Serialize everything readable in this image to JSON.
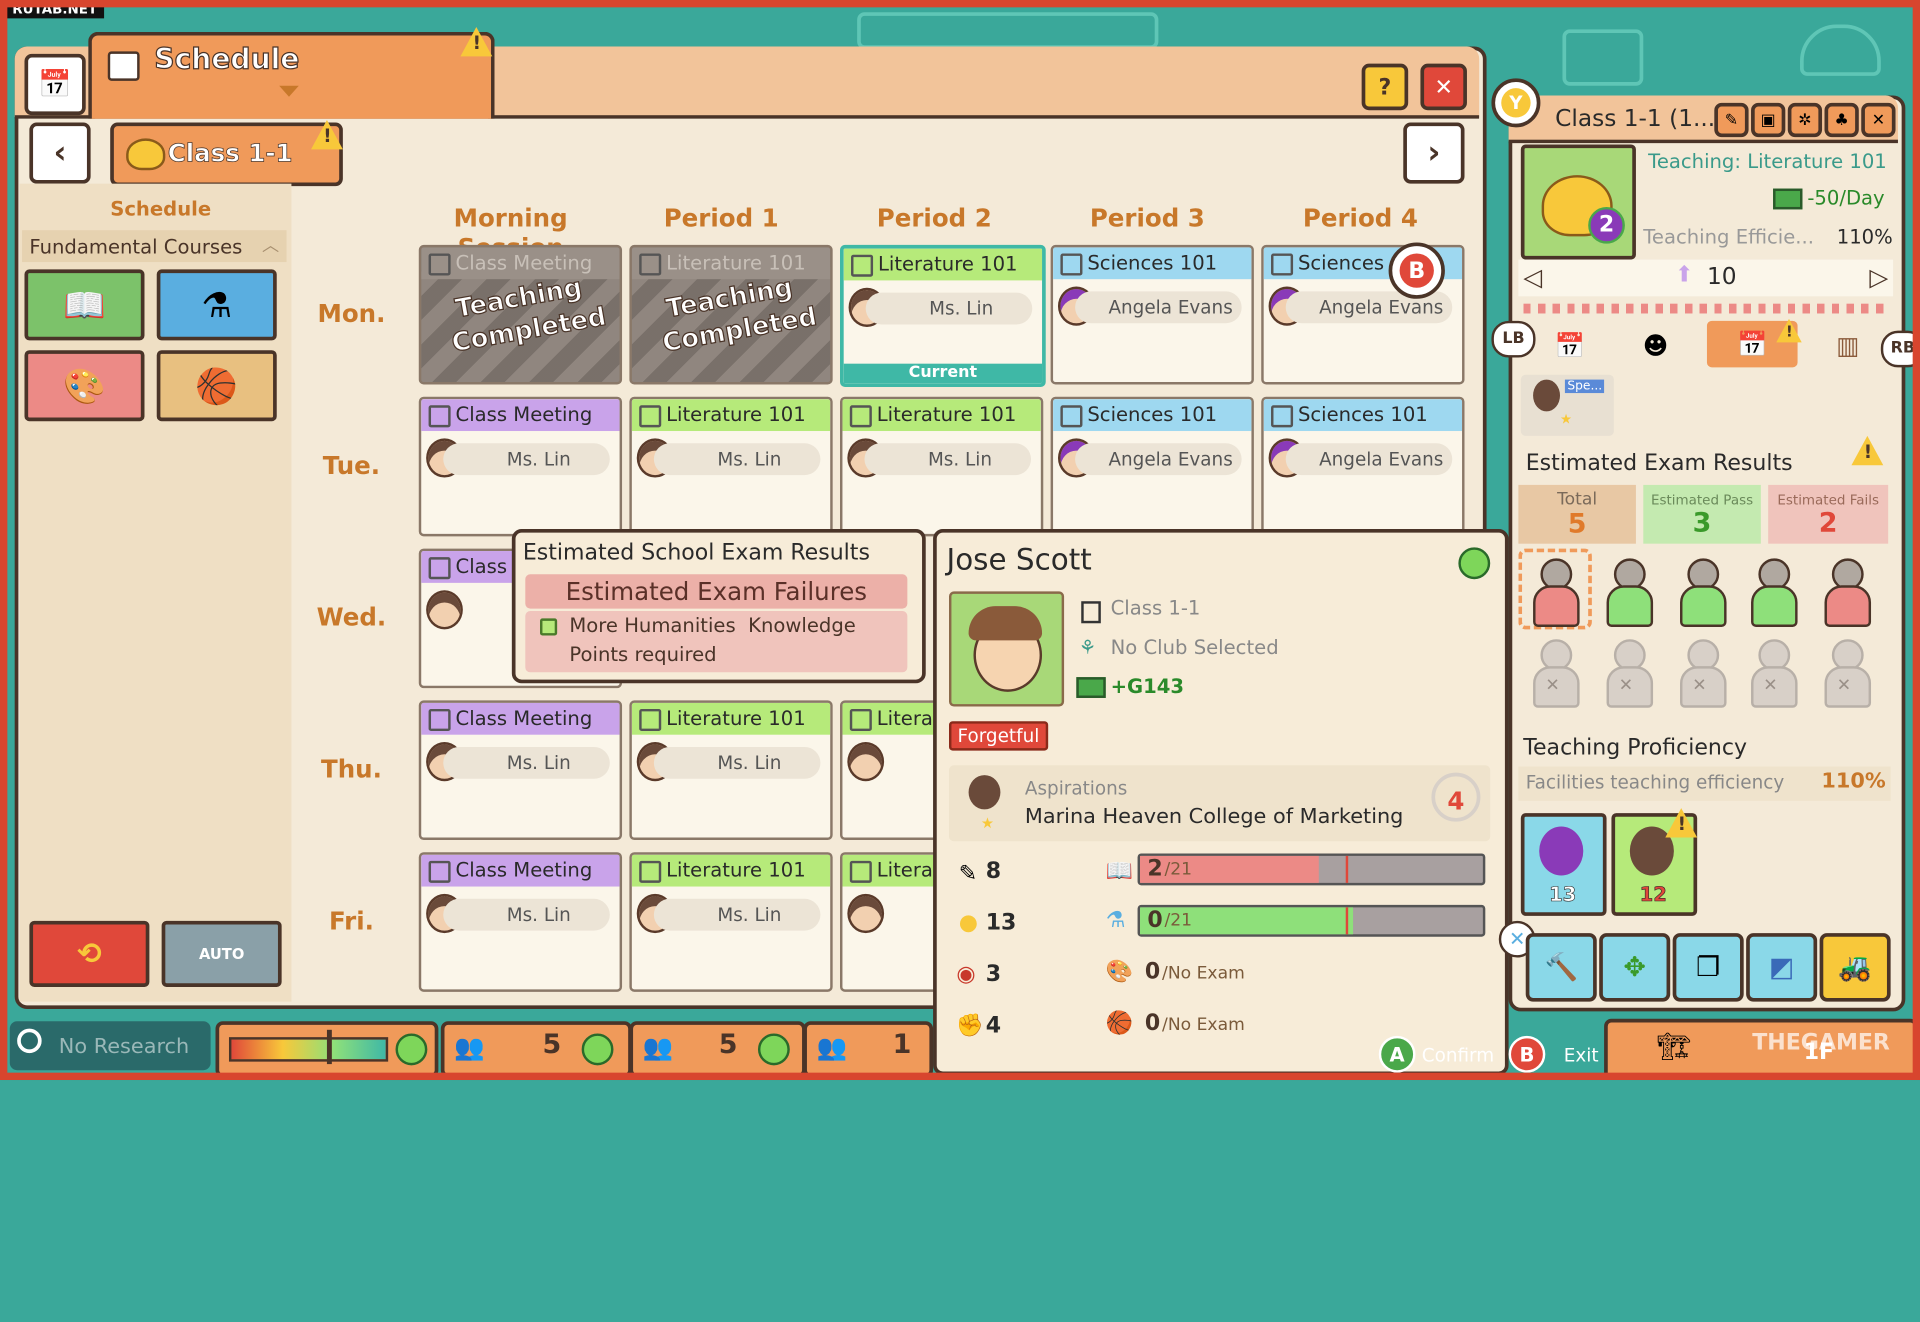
{
  "watermark": "RUTAB.NET",
  "schedule_window": {
    "title": "Schedule",
    "class_button": "Class 1-1",
    "sidebar_title": "Schedule",
    "fundamental_header": "Fundamental Courses",
    "columns": [
      "Morning Session",
      "Period 1",
      "Period 2",
      "Period 3",
      "Period 4"
    ],
    "days": [
      "Mon.",
      "Tue.",
      "Wed.",
      "Thu.",
      "Fri."
    ],
    "completed_text_1": "Teaching",
    "completed_text_2": "Completed",
    "current_label": "Current",
    "cells": {
      "mon0": {
        "course": "Class Meeting"
      },
      "mon1": {
        "course": "Literature 101"
      },
      "mon2": {
        "course": "Literature 101",
        "teacher": "Ms. Lin"
      },
      "mon3": {
        "course": "Sciences 101",
        "teacher": "Angela Evans"
      },
      "mon4": {
        "course": "Sciences",
        "teacher": "Angela Evans"
      },
      "tue0": {
        "course": "Class Meeting",
        "teacher": "Ms. Lin"
      },
      "tue1": {
        "course": "Literature 101",
        "teacher": "Ms. Lin"
      },
      "tue2": {
        "course": "Literature 101",
        "teacher": "Ms. Lin"
      },
      "tue3": {
        "course": "Sciences 101",
        "teacher": "Angela Evans"
      },
      "tue4": {
        "course": "Sciences 101",
        "teacher": "Angela Evans"
      },
      "wed0": {
        "course": "Class"
      },
      "thu0": {
        "course": "Class Meeting",
        "teacher": "Ms. Lin"
      },
      "thu1": {
        "course": "Literature 101",
        "teacher": "Ms. Lin"
      },
      "thu2": {
        "course": "Litera"
      },
      "fri0": {
        "course": "Class Meeting",
        "teacher": "Ms. Lin"
      },
      "fri1": {
        "course": "Literature 101",
        "teacher": "Ms. Lin"
      },
      "fri2": {
        "course": "Litera"
      }
    }
  },
  "exam_popup": {
    "title": "Estimated School Exam Results",
    "failure_header": "Estimated Exam Failures",
    "requirement_line1": "More Humanities  Knowledge",
    "requirement_line2": "Points required"
  },
  "student_popup": {
    "name": "Jose Scott",
    "class": "Class 1-1",
    "club": "No Club Selected",
    "money": "+G143",
    "trait": "Forgetful",
    "aspirations_label": "Aspirations",
    "aspiration": "Marina Heaven College of Marketing",
    "aspiration_count": "4",
    "stats": [
      {
        "value": "8",
        "score": "2",
        "max": "/21",
        "fill": 0.52,
        "marker": 0.6,
        "color": "#ec8a86"
      },
      {
        "value": "13",
        "score": "0",
        "max": "/21",
        "fill": 0.62,
        "marker": 0.6,
        "color": "#8ee07a"
      },
      {
        "value": "3",
        "score": "0",
        "max": "/No Exam"
      },
      {
        "value": "4",
        "score": "0",
        "max": "/No Exam"
      }
    ]
  },
  "class_panel": {
    "title": "Class 1-1 (1...",
    "teaching": "Teaching: Literature 101",
    "cost": "-50/Day",
    "efficiency_label": "Teaching Efficie...",
    "efficiency_value": "110%",
    "level": "10",
    "badge_number": "2",
    "student_tag": "Spe...",
    "exam_title": "Estimated Exam Results",
    "total_label": "Total",
    "total_value": "5",
    "pass_label": "Estimated Pass",
    "pass_value": "3",
    "fail_label": "Estimated Fails",
    "fail_value": "2",
    "proficiency_title": "Teaching Proficiency",
    "facilities_label": "Facilities teaching efficiency",
    "facilities_value": "110%",
    "teacher1_num": "13",
    "teacher2_num": "12",
    "lb": "LB",
    "rb": "RB",
    "y_btn": "Y"
  },
  "bottom_bar": {
    "research": "No Research",
    "count1": "5",
    "count2": "5",
    "count3": "1",
    "confirm": "Confirm",
    "exit": "Exit",
    "floor": "1F",
    "a": "A",
    "b": "B",
    "watermark2": "THEGAMER"
  },
  "colors": {
    "accent": "#f09a5a",
    "outline": "#4a3428",
    "teal": "#3fb8a6",
    "danger": "#e0483a"
  }
}
